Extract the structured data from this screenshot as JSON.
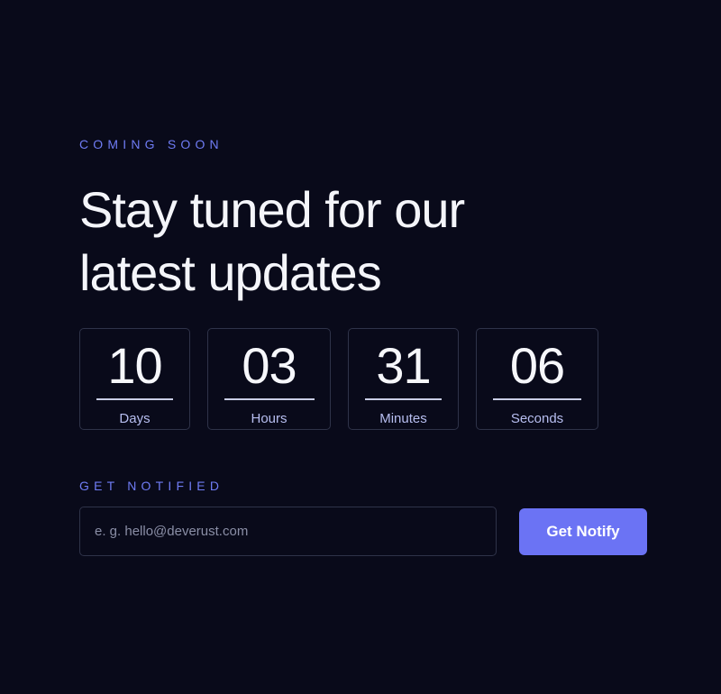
{
  "hero": {
    "eyebrow": "COMING SOON",
    "headline": "Stay tuned for our latest updates"
  },
  "countdown": [
    {
      "value": "10",
      "label": "Days"
    },
    {
      "value": "03",
      "label": "Hours"
    },
    {
      "value": "31",
      "label": "Minutes"
    },
    {
      "value": "06",
      "label": "Seconds"
    }
  ],
  "notify": {
    "label": "GET NOTIFIED",
    "email_placeholder": "e. g. hello@deverust.com",
    "email_value": "",
    "button_label": "Get Notify"
  },
  "colors": {
    "background": "#090a1a",
    "accent": "#6b73f4",
    "eyebrow": "#6f7cf4",
    "border": "#2f3349"
  }
}
